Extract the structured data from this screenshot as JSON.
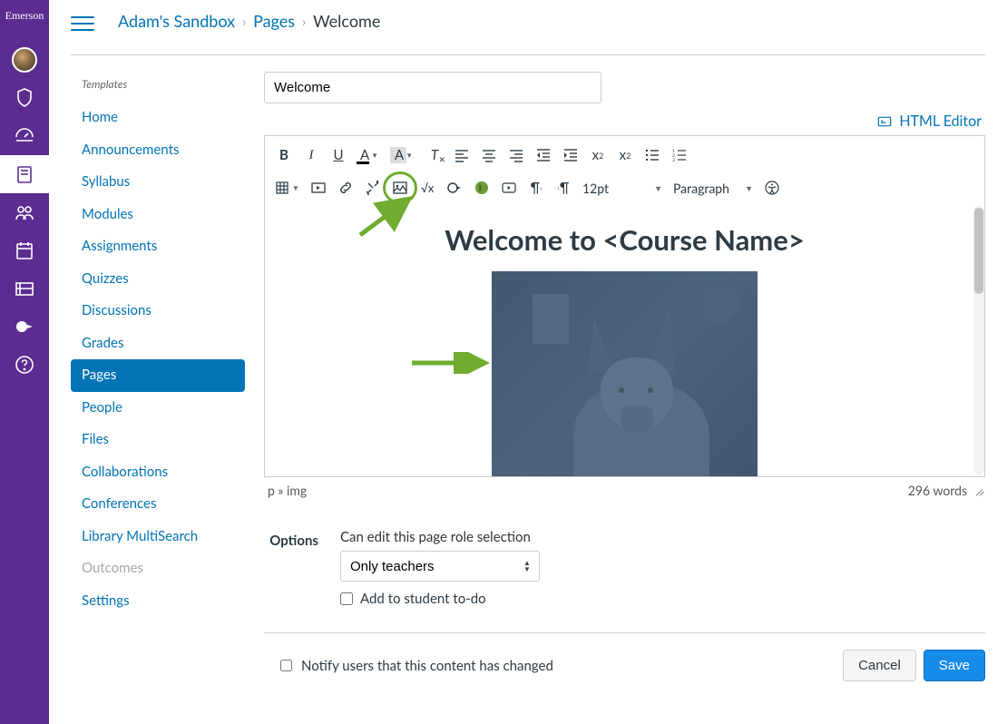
{
  "global_nav": {
    "logo_text": "Emerson"
  },
  "breadcrumb": {
    "course": "Adam's Sandbox",
    "section": "Pages",
    "current": "Welcome"
  },
  "course_nav": {
    "section_label": "Templates",
    "items": [
      {
        "label": "Home",
        "active": false
      },
      {
        "label": "Announcements",
        "active": false
      },
      {
        "label": "Syllabus",
        "active": false
      },
      {
        "label": "Modules",
        "active": false
      },
      {
        "label": "Assignments",
        "active": false
      },
      {
        "label": "Quizzes",
        "active": false
      },
      {
        "label": "Discussions",
        "active": false
      },
      {
        "label": "Grades",
        "active": false
      },
      {
        "label": "Pages",
        "active": true
      },
      {
        "label": "People",
        "active": false
      },
      {
        "label": "Files",
        "active": false
      },
      {
        "label": "Collaborations",
        "active": false
      },
      {
        "label": "Conferences",
        "active": false
      },
      {
        "label": "Library MultiSearch",
        "active": false
      },
      {
        "label": "Outcomes",
        "active": false,
        "disabled": true
      },
      {
        "label": "Settings",
        "active": false
      }
    ]
  },
  "editor": {
    "title_value": "Welcome",
    "html_editor_link": "HTML Editor",
    "font_size": "12pt",
    "block_format": "Paragraph",
    "content_heading": "Welcome to <Course Name>",
    "path": "p » img",
    "word_count": "296 words"
  },
  "options": {
    "label": "Options",
    "role_label": "Can edit this page role selection",
    "role_selected": "Only teachers",
    "todo_label": "Add to student to-do"
  },
  "footer": {
    "notify_label": "Notify users that this content has changed",
    "cancel": "Cancel",
    "save": "Save"
  }
}
